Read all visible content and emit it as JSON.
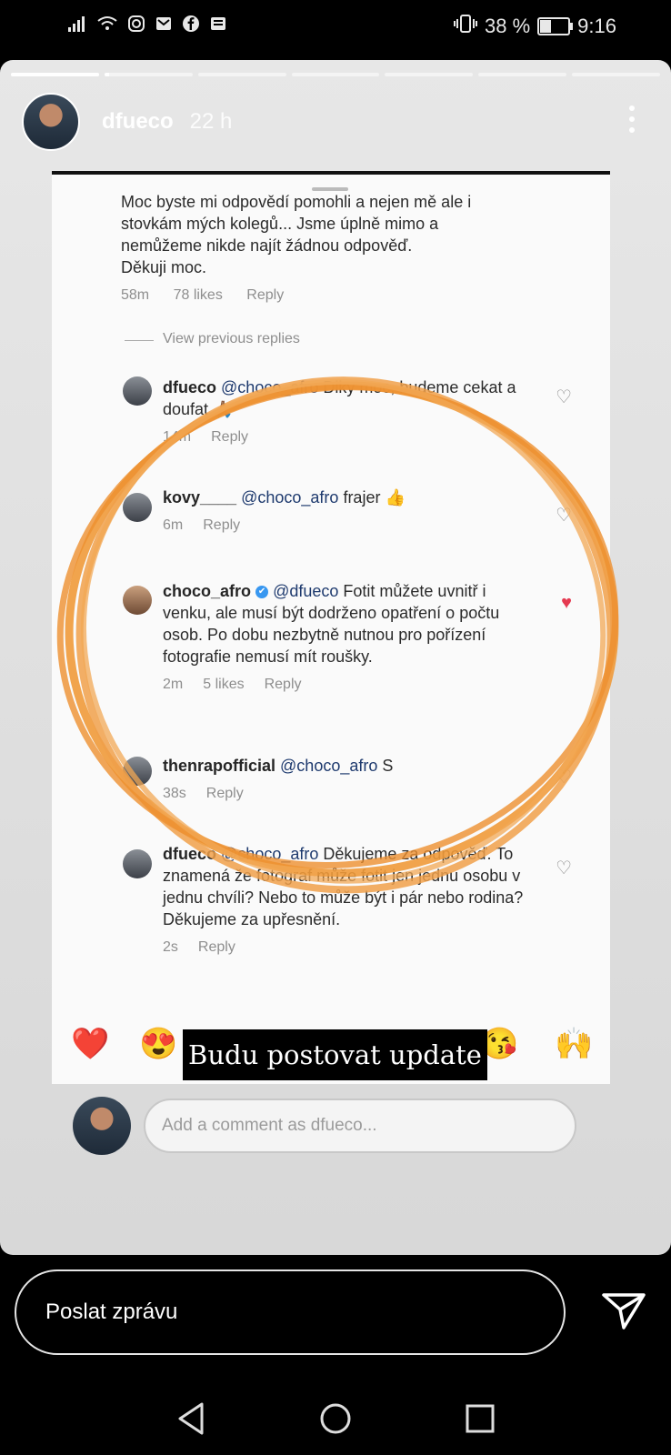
{
  "status_bar": {
    "battery_text": "38 %",
    "battery_level": 0.38,
    "time": "9:16",
    "icons": [
      "signal-icon",
      "wifi-icon",
      "instagram-icon",
      "mail-icon",
      "facebook-icon",
      "news-icon"
    ]
  },
  "story": {
    "progress_segments": [
      1,
      0.05,
      0,
      0,
      0,
      0,
      0
    ],
    "username": "dfueco",
    "time_ago": "22 h"
  },
  "screenshot": {
    "top_comment": {
      "lines": [
        "Moc byste mi odpovědí pomohli a nejen mě ale i",
        "stovkám mých kolegů... Jsme úplně mimo a",
        "nemůžeme nikde najít žádnou odpověď.",
        "Děkuji moc."
      ],
      "time": "58m",
      "likes": "78 likes",
      "reply": "Reply"
    },
    "view_replies": "View previous replies",
    "comments": [
      {
        "user": "dfueco",
        "mention": "@choco_afro",
        "text": " Diky moc, budeme cekat a doufat 🙏🏽",
        "time": "14m",
        "likes": "",
        "reply": "Reply"
      },
      {
        "user": "kovy____",
        "mention": "@choco_afro",
        "text": " frajer 👍",
        "time": "6m",
        "likes": "",
        "reply": "Reply"
      },
      {
        "user": "choco_afro",
        "verified": "✔",
        "mention": "@dfueco",
        "text": " Fotit můžete uvnitř i venku, ale musí být dodrženo opatření o počtu osob. Po dobu nezbytně nutnou pro pořízení fotografie nemusí mít roušky.",
        "time": "2m",
        "likes": "5 likes",
        "reply": "Reply"
      },
      {
        "user": "thenrapofficial",
        "mention": "@choco_afro",
        "text": " S",
        "time": "38s",
        "likes": "",
        "reply": "Reply"
      },
      {
        "user": "dfueco",
        "mention": "@choco_afro",
        "text": " Děkujeme za odpověď. To znamená že fotograf může fotit jen jednu osobu v jednu chvíli? Nebo to může být i pár nebo rodina? Děkujeme za upřesnění.",
        "time": "2s",
        "likes": "",
        "reply": "Reply"
      }
    ]
  },
  "emoji_bar": [
    "❤️",
    "😍",
    "😘",
    "🙌"
  ],
  "caption": "Budu postovat update",
  "comment_placeholder": "Add a comment as dfueco...",
  "reply_placeholder": "Poslat zprávu"
}
